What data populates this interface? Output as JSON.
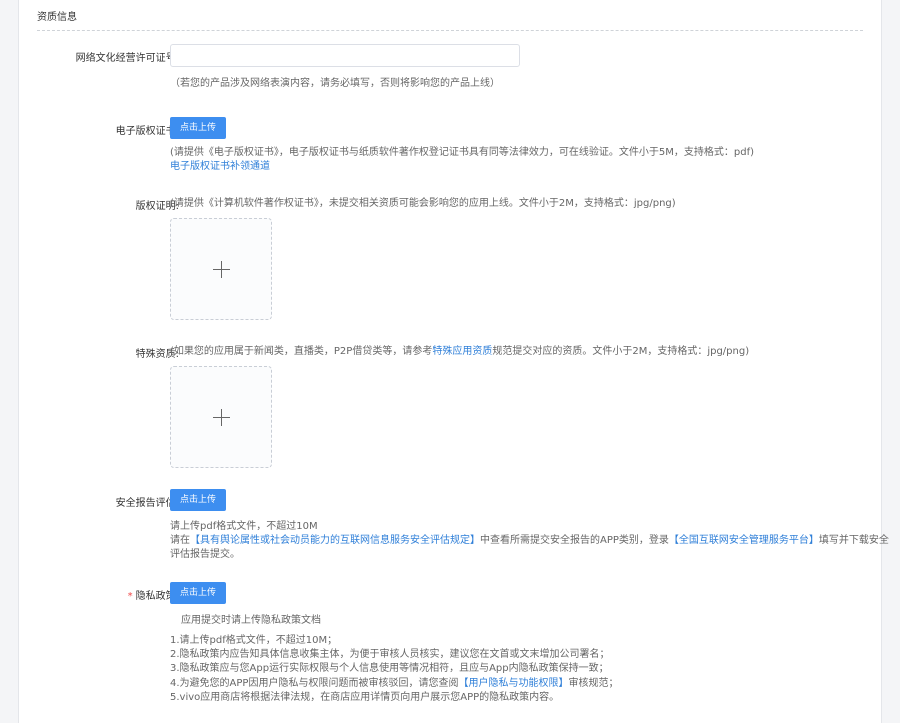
{
  "section": {
    "title": "资质信息"
  },
  "license": {
    "label": "网络文化经营许可证号:",
    "value": "",
    "placeholder": "",
    "hint": "（若您的产品涉及网络表演内容，请务必填写，否则将影响您的产品上线）"
  },
  "ecopyright": {
    "label": "电子版权证书:",
    "button": "点击上传",
    "hint": "(请提供《电子版权证书》，电子版权证书与纸质软件著作权登记证书具有同等法律效力，可在线验证。文件小于5M，支持格式：pdf)",
    "link": "电子版权证书补领通道"
  },
  "copyright_proof": {
    "label": "版权证明:",
    "hint": "(请提供《计算机软件著作权证书》，未提交相关资质可能会影响您的应用上线。文件小于2M，支持格式：jpg/png)"
  },
  "special": {
    "label": "特殊资质:",
    "hint_before": "(如果您的应用属于新闻类，直播类，P2P借贷类等，请参考",
    "hint_link": "特殊应用资质",
    "hint_after": "规范提交对应的资质。文件小于2M，支持格式：jpg/png)"
  },
  "security": {
    "label": "安全报告评估:",
    "button": "点击上传",
    "line1": "请上传pdf格式文件，不超过10M",
    "line2_a": "请在",
    "line2_link1": "【具有舆论属性或社会动员能力的互联网信息服务安全评估规定】",
    "line2_b": "中查看所需提交安全报告的APP类别，登录",
    "line2_link2": "【全国互联网安全管理服务平台】",
    "line2_c": "填写并下载安全",
    "line3": "评估报告提交。"
  },
  "privacy": {
    "required": "*",
    "label": "隐私政策:",
    "button": "点击上传",
    "hint": "应用提交时请上传隐私政策文档",
    "rules": {
      "r1": "1.请上传pdf格式文件，不超过10M；",
      "r2": "2.隐私政策内应告知具体信息收集主体，为便于审核人员核实，建议您在文首或文末增加公司署名；",
      "r3": "3.隐私政策应与您App运行实际权限与个人信息使用等情况相符，且应与App内隐私政策保持一致；",
      "r4_a": "4.为避免您的APP因用户隐私与权限问题而被审核驳回，请您查阅",
      "r4_link": "【用户隐私与功能权限】",
      "r4_b": "审核规范；",
      "r5": "5.vivo应用商店将根据法律法规，在商店应用详情页向用户展示您APP的隐私政策内容。"
    }
  }
}
